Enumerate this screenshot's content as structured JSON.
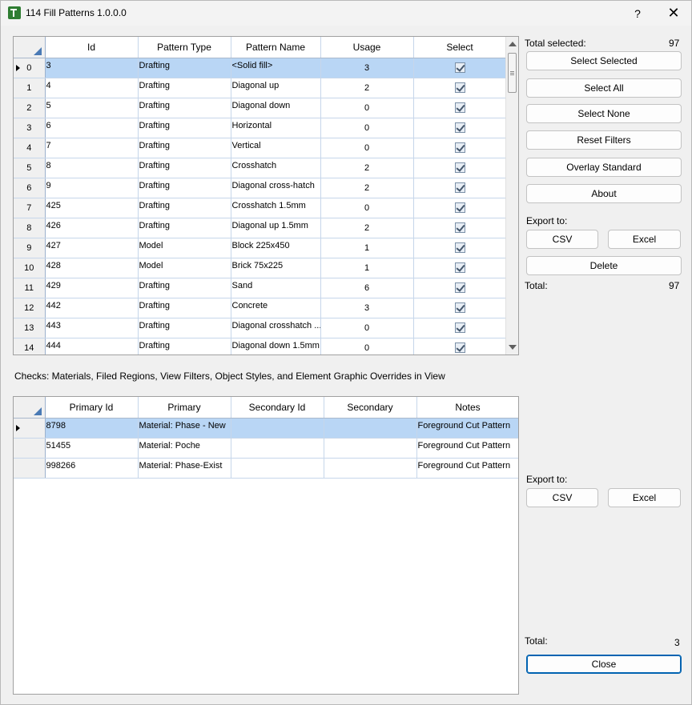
{
  "window": {
    "title": "114 Fill Patterns 1.0.0.0",
    "help_label": "?",
    "close_label": "✕"
  },
  "patterns_grid": {
    "columns": [
      "Id",
      "Pattern Type",
      "Pattern Name",
      "Usage",
      "Select"
    ],
    "rows": [
      {
        "index": "0",
        "id": "3",
        "type": "Drafting",
        "name": "<Solid fill>",
        "usage": "3",
        "select": true
      },
      {
        "index": "1",
        "id": "4",
        "type": "Drafting",
        "name": "Diagonal up",
        "usage": "2",
        "select": true
      },
      {
        "index": "2",
        "id": "5",
        "type": "Drafting",
        "name": "Diagonal down",
        "usage": "0",
        "select": true
      },
      {
        "index": "3",
        "id": "6",
        "type": "Drafting",
        "name": "Horizontal",
        "usage": "0",
        "select": true
      },
      {
        "index": "4",
        "id": "7",
        "type": "Drafting",
        "name": "Vertical",
        "usage": "0",
        "select": true
      },
      {
        "index": "5",
        "id": "8",
        "type": "Drafting",
        "name": "Crosshatch",
        "usage": "2",
        "select": true
      },
      {
        "index": "6",
        "id": "9",
        "type": "Drafting",
        "name": "Diagonal cross-hatch",
        "usage": "2",
        "select": true
      },
      {
        "index": "7",
        "id": "425",
        "type": "Drafting",
        "name": "Crosshatch 1.5mm",
        "usage": "0",
        "select": true
      },
      {
        "index": "8",
        "id": "426",
        "type": "Drafting",
        "name": "Diagonal up 1.5mm",
        "usage": "2",
        "select": true
      },
      {
        "index": "9",
        "id": "427",
        "type": "Model",
        "name": "Block 225x450",
        "usage": "1",
        "select": true
      },
      {
        "index": "10",
        "id": "428",
        "type": "Model",
        "name": "Brick 75x225",
        "usage": "1",
        "select": true
      },
      {
        "index": "11",
        "id": "429",
        "type": "Drafting",
        "name": "Sand",
        "usage": "6",
        "select": true
      },
      {
        "index": "12",
        "id": "442",
        "type": "Drafting",
        "name": "Concrete",
        "usage": "3",
        "select": true
      },
      {
        "index": "13",
        "id": "443",
        "type": "Drafting",
        "name": "Diagonal crosshatch ...",
        "usage": "0",
        "select": true
      },
      {
        "index": "14",
        "id": "444",
        "type": "Drafting",
        "name": "Diagonal down 1.5mm",
        "usage": "0",
        "select": true
      }
    ]
  },
  "top_panel": {
    "total_selected_label": "Total selected:",
    "total_selected_value": "97",
    "select_selected": "Select Selected",
    "select_all": "Select All",
    "select_none": "Select None",
    "reset_filters": "Reset Filters",
    "overlay_standard": "Overlay Standard",
    "about": "About",
    "export_label": "Export to:",
    "csv": "CSV",
    "excel": "Excel",
    "delete": "Delete",
    "total_label": "Total:",
    "total_value": "97"
  },
  "checks_text": "Checks: Materials, Filed Regions, View Filters, Object Styles, and Element Graphic Overrides in View",
  "usage_grid": {
    "columns": [
      "Primary Id",
      "Primary",
      "Secondary Id",
      "Secondary",
      "Notes"
    ],
    "rows": [
      {
        "primary_id": "8798",
        "primary": "Material: Phase - New",
        "secondary_id": "",
        "secondary": "",
        "notes": "Foreground Cut Pattern"
      },
      {
        "primary_id": "51455",
        "primary": "Material: Poche",
        "secondary_id": "",
        "secondary": "",
        "notes": "Foreground Cut Pattern"
      },
      {
        "primary_id": "998266",
        "primary": "Material: Phase-Exist",
        "secondary_id": "",
        "secondary": "",
        "notes": "Foreground Cut Pattern"
      }
    ]
  },
  "bottom_panel": {
    "export_label": "Export to:",
    "csv": "CSV",
    "excel": "Excel",
    "total_label": "Total:",
    "total_value": "3",
    "close": "Close"
  },
  "colors": {
    "selection": "#b9d6f5",
    "grid_line": "#c6d6ea",
    "accent": "#0063b1"
  }
}
